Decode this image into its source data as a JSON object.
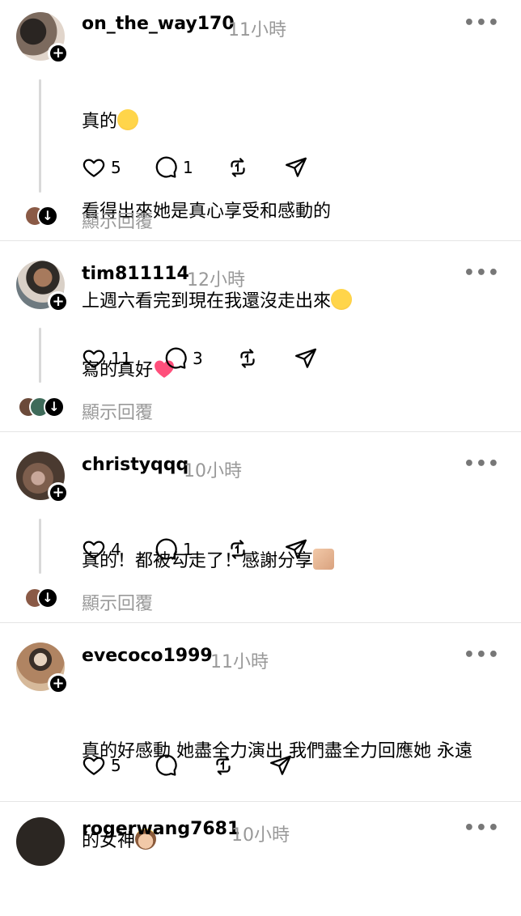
{
  "posts": [
    {
      "username": "on_the_way170",
      "time": "11小時",
      "lines": [
        "真的",
        "看得出來她是真心享受和感動的",
        "上週六看完到現在我還沒走出來"
      ],
      "likes": "5",
      "comments": "1",
      "show_replies": "顯示回覆"
    },
    {
      "username": "tim811114",
      "time": "12小時",
      "lines": [
        "寫的真好"
      ],
      "likes": "11",
      "comments": "3",
      "show_replies": "顯示回覆"
    },
    {
      "username": "christyqqq",
      "time": "10小時",
      "lines": [
        "真的！都被勾走了！感謝分享"
      ],
      "likes": "4",
      "comments": "1",
      "show_replies": "顯示回覆"
    },
    {
      "username": "evecoco1999",
      "time": "11小時",
      "lines": [
        "真的好感動 她盡全力演出 我們盡全力回應她 永遠",
        "的女神"
      ],
      "likes": "5",
      "comments": ""
    },
    {
      "username": "rogerwang7681",
      "time": "10小時"
    }
  ],
  "icons": {
    "like": "heart-outline-icon",
    "comment": "speech-bubble-icon",
    "repost": "repost-icon",
    "share": "send-icon",
    "more": "ellipsis-icon",
    "follow": "plus-icon",
    "expand": "arrow-down-icon"
  }
}
